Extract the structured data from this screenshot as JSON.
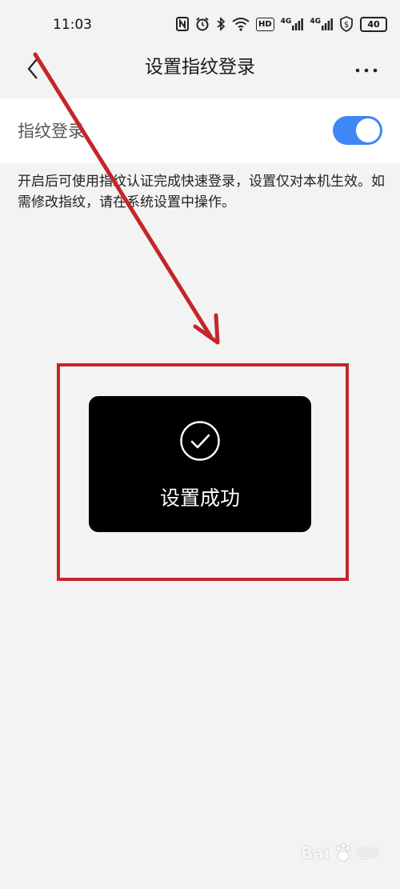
{
  "status_bar": {
    "time": "11:03",
    "hd_label": "HD",
    "signal_label_1": "4G",
    "signal_label_2": "4G",
    "battery": "40"
  },
  "nav": {
    "title": "设置指纹登录",
    "back_icon": "chevron-left-icon",
    "more_icon": "more-horizontal-icon"
  },
  "setting": {
    "label": "指纹登录",
    "toggle_on": true,
    "accent_color": "#3e87f5"
  },
  "description": "开启后可使用指纹认证完成快速登录，设置仅对本机生效。如需修改指纹，请在系统设置中操作。",
  "toast": {
    "icon": "check-circle-icon",
    "message": "设置成功"
  },
  "annotation": {
    "color": "#c4262a"
  },
  "watermark": {
    "logo_text": "Bai",
    "sub_text": "经验"
  }
}
